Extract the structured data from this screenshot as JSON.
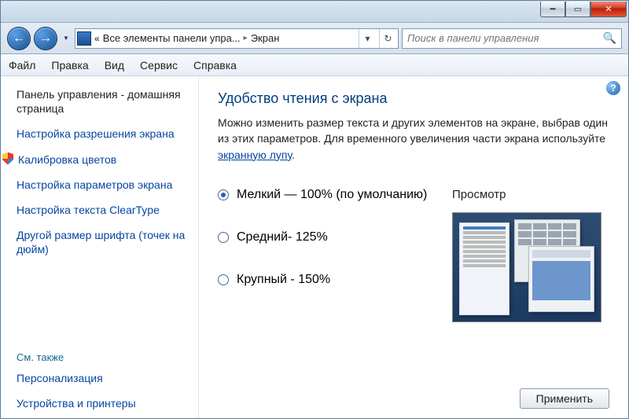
{
  "titlebar": {
    "min": "━",
    "max": "▭",
    "close": "✕"
  },
  "nav": {
    "back": "←",
    "forward": "→",
    "dropdown": "▼"
  },
  "address": {
    "chevrons": "«",
    "crumb1": "Все элементы панели упра...",
    "sep": "▸",
    "crumb2": "Экран",
    "drop": "▾",
    "refresh": "↻"
  },
  "search": {
    "placeholder": "Поиск в панели управления",
    "icon": "🔍"
  },
  "menu": {
    "file": "Файл",
    "edit": "Правка",
    "view": "Вид",
    "service": "Сервис",
    "help": "Справка"
  },
  "sidebar": {
    "home": "Панель управления - домашняя страница",
    "link1": "Настройка разрешения экрана",
    "link2": "Калибровка цветов",
    "link3": "Настройка параметров экрана",
    "link4": "Настройка текста ClearType",
    "link5": "Другой размер шрифта (точек на дюйм)",
    "see_also": "См. также",
    "link6": "Персонализация",
    "link7": "Устройства и принтеры"
  },
  "main": {
    "help": "?",
    "title": "Удобство чтения с экрана",
    "desc_part1": "Можно изменить размер текста и других элементов на экране, выбрав один из этих параметров. Для временного увеличения части экрана используйте ",
    "desc_link": "экранную лупу",
    "desc_part2": ".",
    "opt1": "Мелкий — 100% (по умолчанию)",
    "opt2": "Средний- 125%",
    "opt3": "Крупный - 150%",
    "preview_label": "Просмотр",
    "apply": "Применить"
  }
}
